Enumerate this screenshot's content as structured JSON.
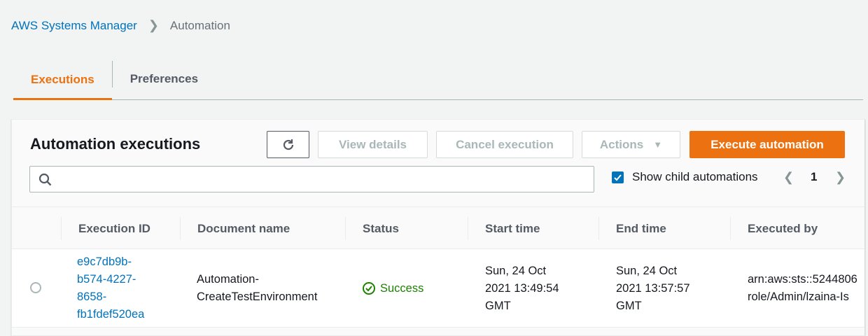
{
  "breadcrumb": {
    "root": "AWS Systems Manager",
    "current": "Automation"
  },
  "tabs": [
    {
      "label": "Executions",
      "active": true
    },
    {
      "label": "Preferences",
      "active": false
    }
  ],
  "panel": {
    "title": "Automation executions",
    "buttons": {
      "view_details": "View details",
      "cancel": "Cancel execution",
      "actions": "Actions",
      "execute": "Execute automation"
    },
    "search": {
      "placeholder": "",
      "value": ""
    },
    "show_child": {
      "label": "Show child automations",
      "checked": true
    },
    "page": "1"
  },
  "table": {
    "columns": [
      "Execution ID",
      "Document name",
      "Status",
      "Start time",
      "End time",
      "Executed by"
    ],
    "rows": [
      {
        "id_lines": [
          "e9c7db9b-",
          "b574-4227-",
          "8658-",
          "fb1fdef520ea"
        ],
        "doc_lines": [
          "Automation-",
          "CreateTestEnvironment"
        ],
        "status": "Success",
        "start_lines": [
          "Sun, 24 Oct",
          "2021 13:49:54",
          "GMT"
        ],
        "end_lines": [
          "Sun, 24 Oct",
          "2021 13:57:57",
          "GMT"
        ],
        "by_lines": [
          "arn:aws:sts::5244806",
          "role/Admin/lzaina-Is"
        ]
      }
    ]
  },
  "colors": {
    "accent": "#ec7211",
    "link": "#0073bb",
    "success": "#1d8102"
  }
}
